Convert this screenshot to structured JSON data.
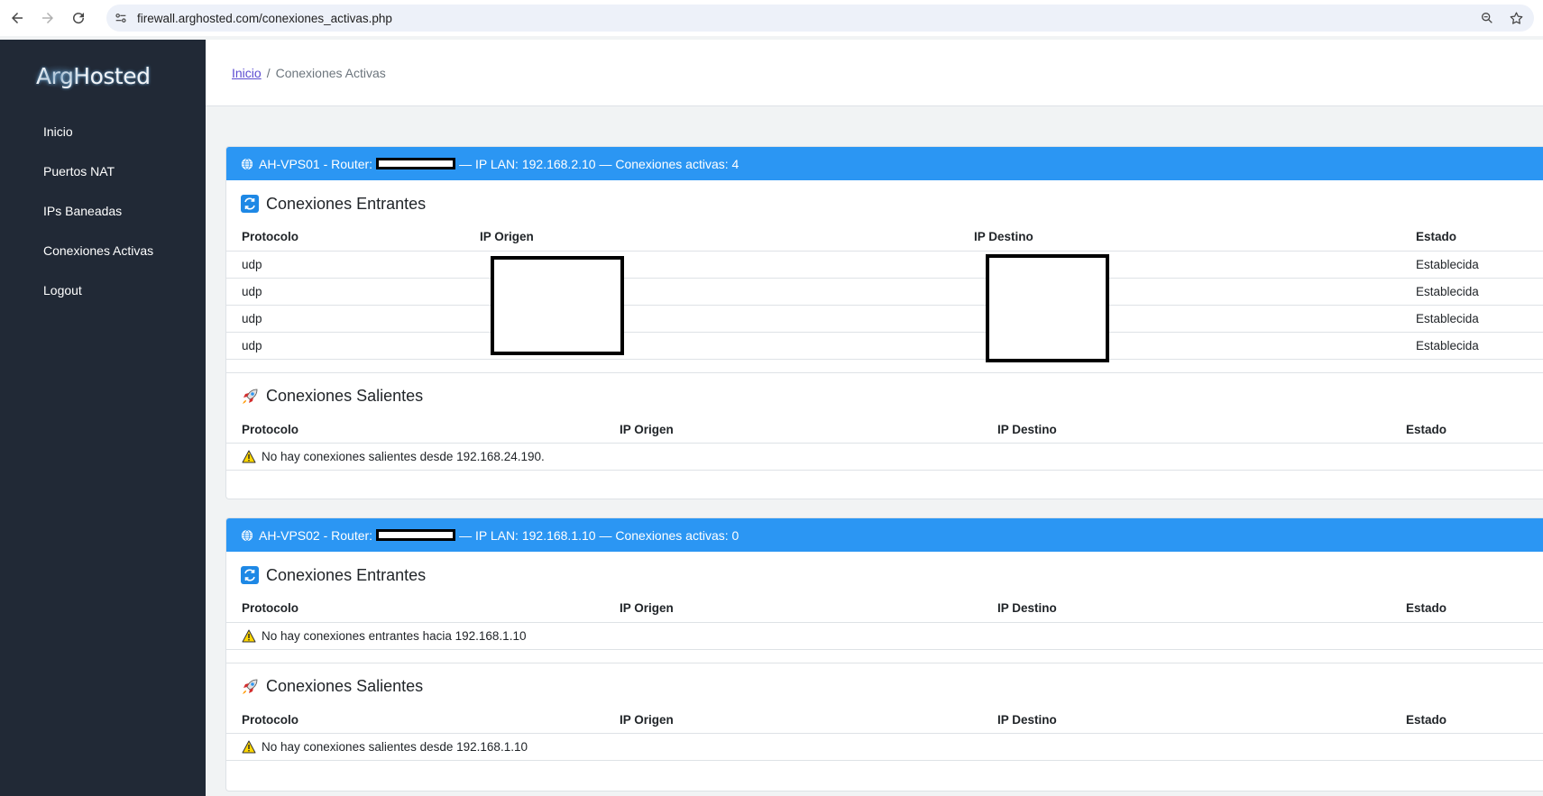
{
  "browser": {
    "url": "firewall.arghosted.com/conexiones_activas.php"
  },
  "sidebar": {
    "logo": "ArgHosted",
    "items": [
      {
        "label": "Inicio"
      },
      {
        "label": "Puertos NAT"
      },
      {
        "label": "IPs Baneadas"
      },
      {
        "label": "Conexiones Activas"
      },
      {
        "label": "Logout"
      }
    ]
  },
  "breadcrumb": {
    "home": "Inicio",
    "separator": "/",
    "current": "Conexiones Activas"
  },
  "columns": {
    "protocol": "Protocolo",
    "src": "IP Origen",
    "dst": "IP Destino",
    "state": "Estado"
  },
  "cards": [
    {
      "header_prefix": "AH-VPS01 - Router:",
      "header_suffix": "— IP LAN: 192.168.2.10 — Conexiones activas: 4",
      "incoming_title": "Conexiones Entrantes",
      "incoming_rows": [
        {
          "protocol": "udp",
          "state": "Establecida"
        },
        {
          "protocol": "udp",
          "state": "Establecida"
        },
        {
          "protocol": "udp",
          "state": "Establecida"
        },
        {
          "protocol": "udp",
          "state": "Establecida"
        }
      ],
      "outgoing_title": "Conexiones Salientes",
      "outgoing_empty": "No hay conexiones salientes desde 192.168.24.190."
    },
    {
      "header_prefix": "AH-VPS02 - Router:",
      "header_suffix": "— IP LAN: 192.168.1.10 — Conexiones activas: 0",
      "incoming_title": "Conexiones Entrantes",
      "incoming_empty": "No hay conexiones entrantes hacia 192.168.1.10",
      "outgoing_title": "Conexiones Salientes",
      "outgoing_empty": "No hay conexiones salientes desde 192.168.1.10"
    }
  ],
  "colors": {
    "sidebar_bg": "#212936",
    "card_header_bg": "#2b96f3",
    "page_bg": "#f1f3f4"
  }
}
